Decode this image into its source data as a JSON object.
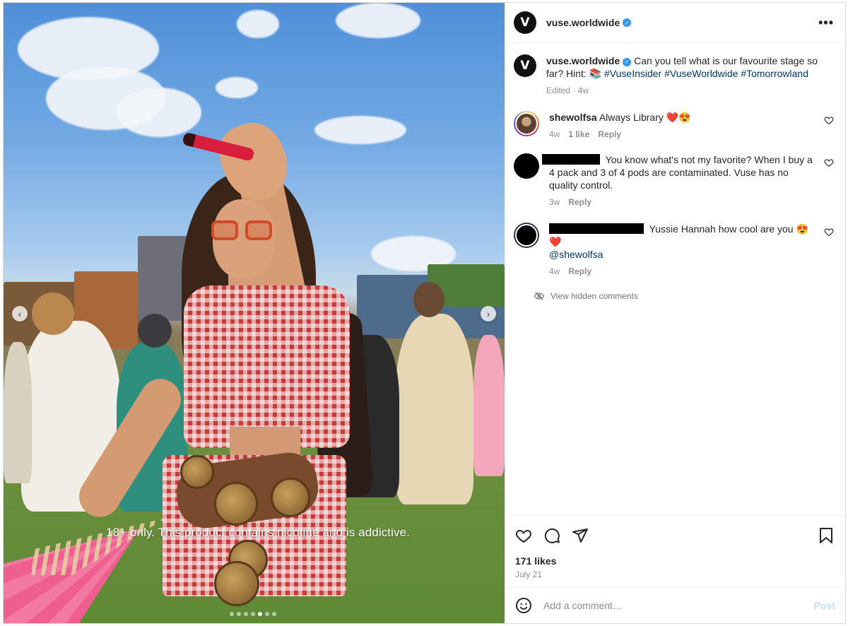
{
  "post": {
    "username": "vuse.worldwide",
    "avatar_letter": "V",
    "caption_text": "Can you tell what is our favourite stage so far? Hint: 📚 ",
    "caption_hashtags": [
      "#VuseInsider",
      "#VuseWorldwide",
      "#Tomorrowland"
    ],
    "caption_meta": "Edited · 4w"
  },
  "media": {
    "overlay_text": "18+ only. This product contains nicotine and is addictive.",
    "prev_glyph": "‹",
    "next_glyph": "›",
    "carousel_dots": 7,
    "active_dot": 5
  },
  "comments": [
    {
      "username": "shewolfsa",
      "text": "Always Library ❤️😍",
      "time": "4w",
      "likes": "1 like",
      "reply": "Reply"
    },
    {
      "username": "",
      "text": "You know what's not my favorite? When I buy a 4 pack and 3 of 4 pods are contaminated. Vuse has no quality control.",
      "time": "3w",
      "reply": "Reply"
    },
    {
      "username": "",
      "text": "Yussie Hannah how cool are you 😍❤️",
      "mention": "@shewolfsa",
      "time": "4w",
      "reply": "Reply"
    }
  ],
  "hidden_comments_label": "View hidden comments",
  "engagement": {
    "likes": "171 likes",
    "date": "July 21"
  },
  "comment_box": {
    "placeholder": "Add a comment…",
    "post_label": "Post"
  },
  "header": {
    "more_glyph": "•••"
  },
  "colors": {
    "link": "#00376b",
    "verified": "#3897f0",
    "muted": "#8e8e8e",
    "post_disabled": "#c0dffd"
  }
}
